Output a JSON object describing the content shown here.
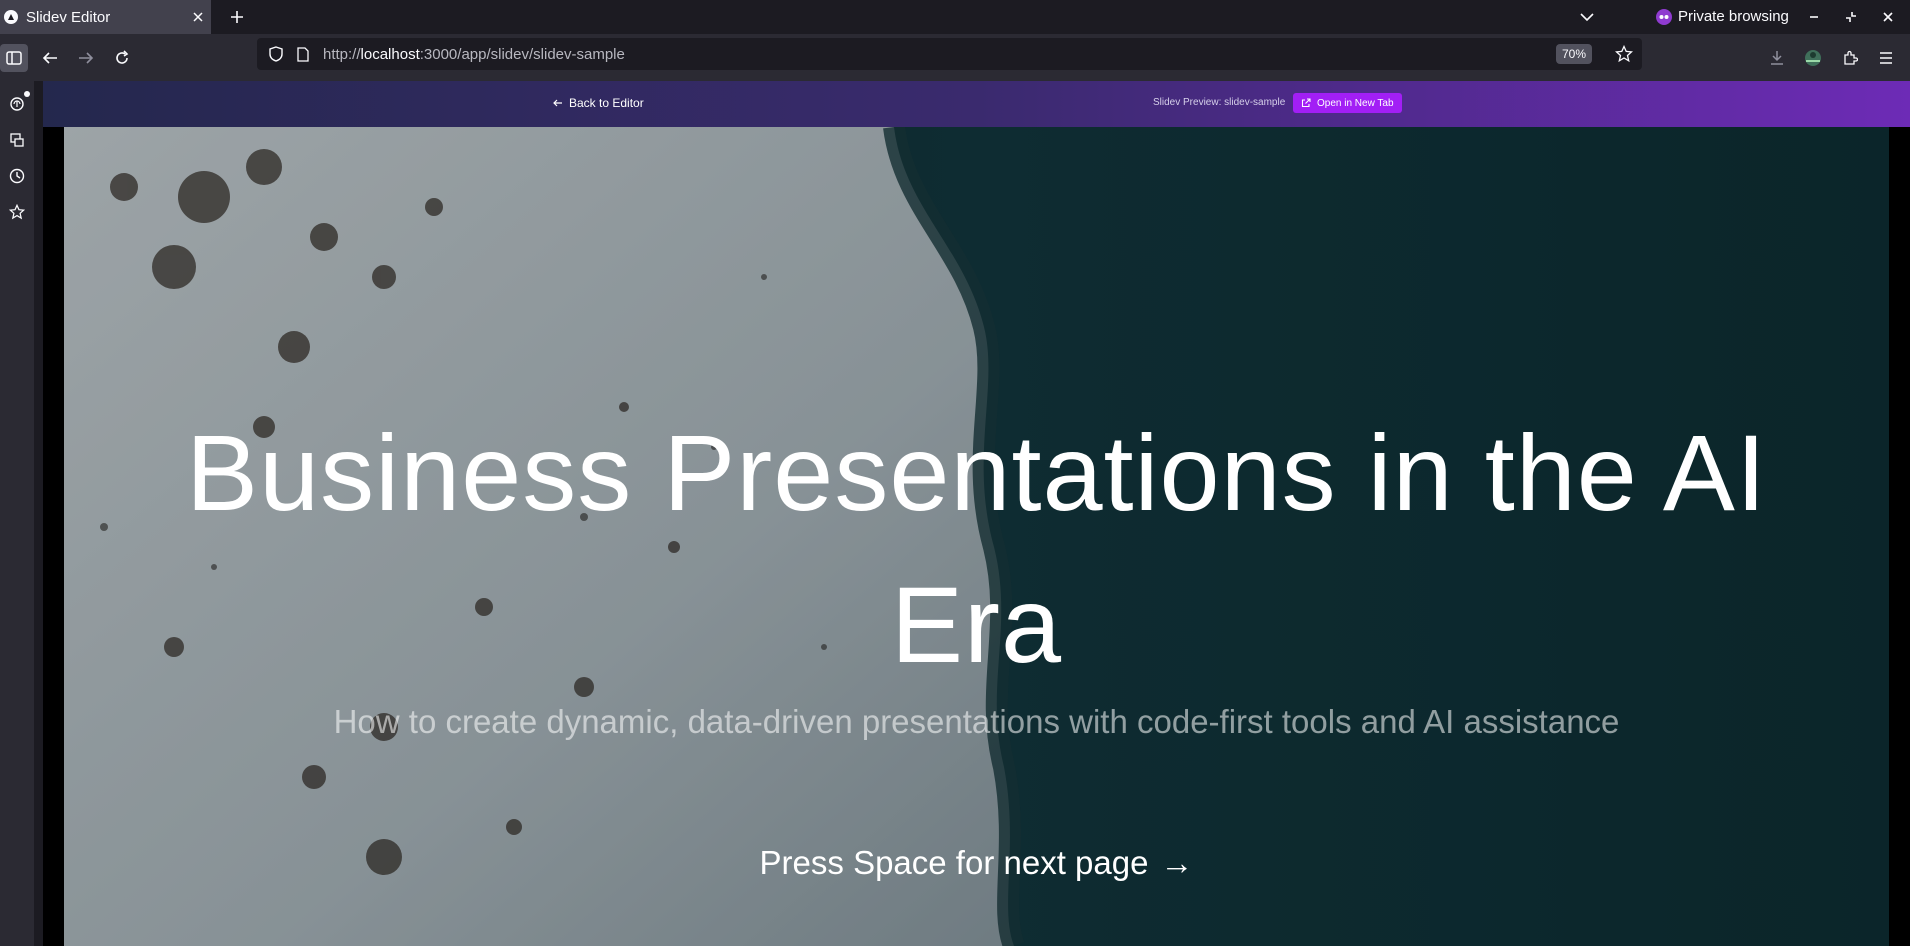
{
  "browser": {
    "tab_title": "Slidev Editor",
    "private_label": "Private browsing",
    "url_scheme": "http://",
    "url_host": "localhost",
    "url_rest": ":3000/app/slidev/slidev-sample",
    "zoom": "70%"
  },
  "preview": {
    "back_label": "Back to Editor",
    "title": "Slidev Preview: slidev-sample",
    "open_button": "Open in New Tab"
  },
  "slide": {
    "title": "Business Presentations in the AI Era",
    "subtitle": "How to create dynamic, data-driven presentations with code-first tools and AI assistance",
    "next_hint": "Press Space for next page",
    "next_arrow": "→"
  },
  "colors": {
    "header_gradient_start": "#24284d",
    "header_gradient_end": "#6d2bb6",
    "open_button": "#a21ff5"
  }
}
